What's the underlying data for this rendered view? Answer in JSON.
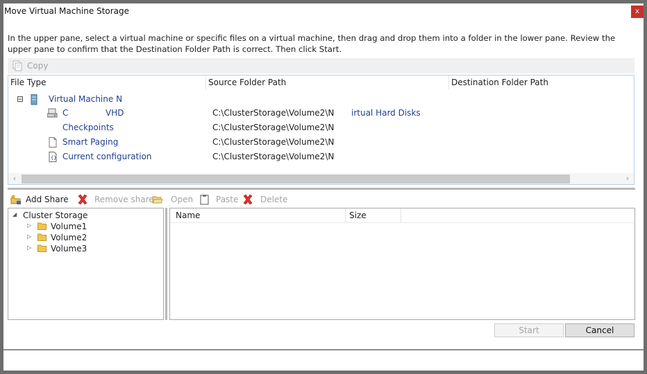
{
  "window": {
    "title": "Move Virtual Machine Storage",
    "close_glyph": "x"
  },
  "instructions": "In the upper pane, select a virtual machine or specific files on a virtual machine, then drag and drop them into a folder in the lower pane.  Review the upper pane to confirm that the Destination Folder Path is correct. Then click Start.",
  "upper_toolbar": {
    "copy_label": "Copy"
  },
  "upper_grid": {
    "columns": [
      "File Type",
      "Source Folder Path",
      "Destination Folder Path"
    ],
    "root": {
      "expander": "⊟",
      "label": "Virtual Machine N"
    },
    "rows": [
      {
        "label": "C",
        "label2": "VHD",
        "source": "C:\\ClusterStorage\\Volume2\\N",
        "source2": "irtual Hard Disks",
        "icon": "disk-icon"
      },
      {
        "label": "Checkpoints",
        "source": "C:\\ClusterStorage\\Volume2\\N",
        "icon": ""
      },
      {
        "label": "Smart Paging",
        "source": "C:\\ClusterStorage\\Volume2\\N",
        "icon": "document-icon"
      },
      {
        "label": "Current configuration",
        "source": "C:\\ClusterStorage\\Volume2\\N",
        "icon": "config-file-icon"
      }
    ],
    "scroll_left": "‹",
    "scroll_right": "›"
  },
  "lower_toolbar": {
    "add_share": "Add Share",
    "remove_share": "Remove share",
    "open": "Open",
    "paste": "Paste",
    "delete": "Delete"
  },
  "storage_tree": {
    "root": {
      "expander": "◢",
      "label": "Cluster Storage"
    },
    "items": [
      {
        "expander": "▷",
        "label": "Volume1"
      },
      {
        "expander": "▷",
        "label": "Volume2"
      },
      {
        "expander": "▷",
        "label": "Volume3"
      }
    ]
  },
  "file_list": {
    "columns": [
      "Name",
      "Size"
    ]
  },
  "buttons": {
    "start": "Start",
    "cancel": "Cancel"
  },
  "colors": {
    "link": "#1f3f91",
    "close": "#c7312b",
    "disabled_text": "#a3a3a3"
  }
}
